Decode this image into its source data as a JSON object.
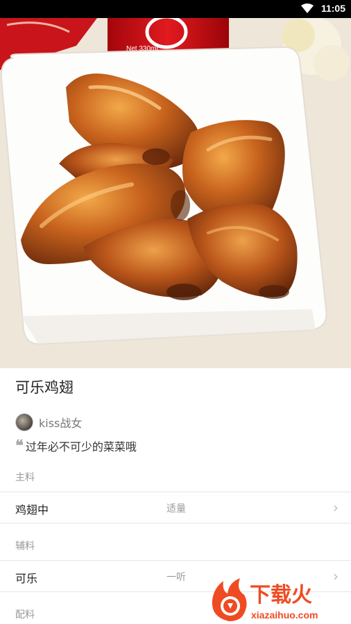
{
  "status_bar": {
    "time": "11:05",
    "wifi_icon": "wifi-icon"
  },
  "recipe": {
    "title": "可乐鸡翅",
    "author": "kiss战女",
    "description": "过年必不可少的菜菜哦",
    "quote_icon": "quote-icon"
  },
  "hero_image": {
    "can_text": "Net 330mL"
  },
  "ingredients": {
    "main_label": "主料",
    "main": [
      {
        "name": "鸡翅中",
        "amount": "适量"
      }
    ],
    "aux_label": "辅料",
    "aux": [
      {
        "name": "可乐",
        "amount": "一听"
      }
    ],
    "seasoning_label": "配料"
  },
  "watermark": {
    "brand": "下载火",
    "domain": "xiazaihuo.com"
  }
}
